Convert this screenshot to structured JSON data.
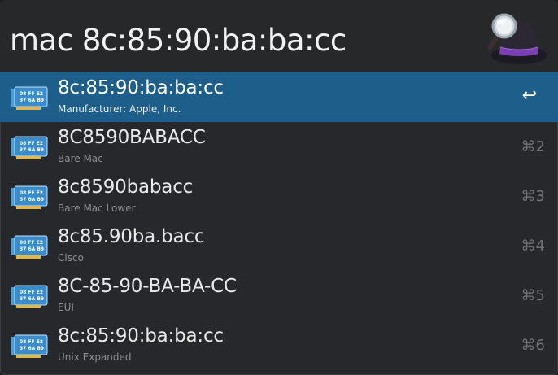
{
  "search": {
    "query": "mac 8c:85:90:ba:ba:cc"
  },
  "icon": {
    "name": "network-card-icon",
    "line1": "08 FF E2",
    "line2": "37 6A B9"
  },
  "colors": {
    "window_bg": "#26282b",
    "selection": "#1d5f8a",
    "text_primary": "#e9e9e9",
    "text_secondary": "#8c8f93",
    "shortcut": "#6f7276"
  },
  "results": [
    {
      "title": "8c:85:90:ba:ba:cc",
      "subtitle": "Manufacturer: Apple, Inc.",
      "shortcut": "↩",
      "selected": true
    },
    {
      "title": "8C8590BABACC",
      "subtitle": "Bare Mac",
      "shortcut": "⌘2",
      "selected": false
    },
    {
      "title": "8c8590babacc",
      "subtitle": "Bare Mac Lower",
      "shortcut": "⌘3",
      "selected": false
    },
    {
      "title": "8c85.90ba.bacc",
      "subtitle": "Cisco",
      "shortcut": "⌘4",
      "selected": false
    },
    {
      "title": "8C-85-90-BA-BA-CC",
      "subtitle": "EUI",
      "shortcut": "⌘5",
      "selected": false
    },
    {
      "title": "8c:85:90:ba:ba:cc",
      "subtitle": "Unix Expanded",
      "shortcut": "⌘6",
      "selected": false
    }
  ]
}
